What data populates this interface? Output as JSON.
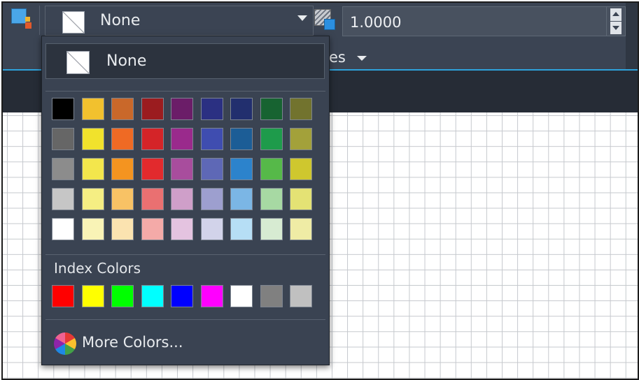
{
  "toolbar": {
    "fill_color_combo": {
      "label": "None"
    },
    "transparency": {
      "value": "1.0000"
    },
    "partial_label": "es"
  },
  "dropdown": {
    "none_label": "None",
    "palette_rows": [
      [
        "#000000",
        "#f2c12e",
        "#c9682a",
        "#9b1c1f",
        "#6b1d68",
        "#2b3082",
        "#222f6e",
        "#176331",
        "#72732e"
      ],
      [
        "#666666",
        "#f1e22c",
        "#ef6a24",
        "#d42428",
        "#9a2a8c",
        "#3f4db0",
        "#1c5d96",
        "#1e9b4b",
        "#a3a13a"
      ],
      [
        "#8c8c8c",
        "#f3e64c",
        "#f49420",
        "#e22a2d",
        "#a84d9d",
        "#5e68b6",
        "#2c83cc",
        "#56b949",
        "#cfc72e"
      ],
      [
        "#c6c6c6",
        "#f5ee83",
        "#f8c265",
        "#ea7071",
        "#cf9fc9",
        "#9d9fcf",
        "#7bb6e5",
        "#a7d9a3",
        "#e4e274"
      ],
      [
        "#ffffff",
        "#f9f3b6",
        "#fbe3b0",
        "#f4aaa8",
        "#e4c3e0",
        "#d2d3ea",
        "#b6def5",
        "#d7ebd2",
        "#efeca5"
      ]
    ],
    "index_title": "Index Colors",
    "index_colors": [
      "#ff0000",
      "#ffff00",
      "#00ff00",
      "#00ffff",
      "#0000ff",
      "#ff00ff",
      "#ffffff",
      "#808080",
      "#c0c0c0"
    ],
    "more_colors_label": "More Colors..."
  }
}
